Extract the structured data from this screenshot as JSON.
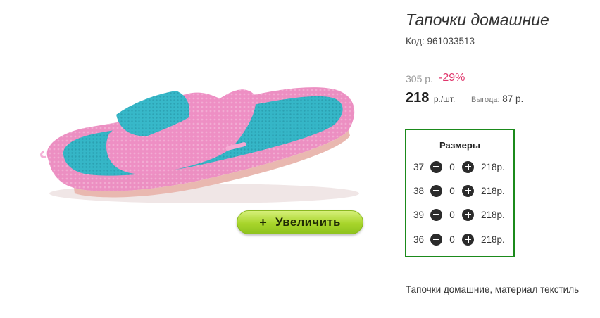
{
  "product": {
    "title": "Тапочки домашние",
    "code_label": "Код: 961033513",
    "old_price": "305 р.",
    "discount": "-29%",
    "price": "218",
    "price_unit": "р./шт.",
    "savings_label": "Выгода:",
    "savings_value": "87 р.",
    "description": "Тапочки домашние, материал текстиль"
  },
  "zoom_button": {
    "icon": "plus-icon",
    "label": "Увеличить"
  },
  "sizes": {
    "title": "Размеры",
    "border_color": "#1b8a1b",
    "rows": [
      {
        "size": "37",
        "qty": "0",
        "price": "218р."
      },
      {
        "size": "38",
        "qty": "0",
        "price": "218р."
      },
      {
        "size": "39",
        "qty": "0",
        "price": "218р."
      },
      {
        "size": "36",
        "qty": "0",
        "price": "218р."
      }
    ]
  },
  "colors": {
    "discount": "#e0366c",
    "button": "#a8d52b"
  }
}
